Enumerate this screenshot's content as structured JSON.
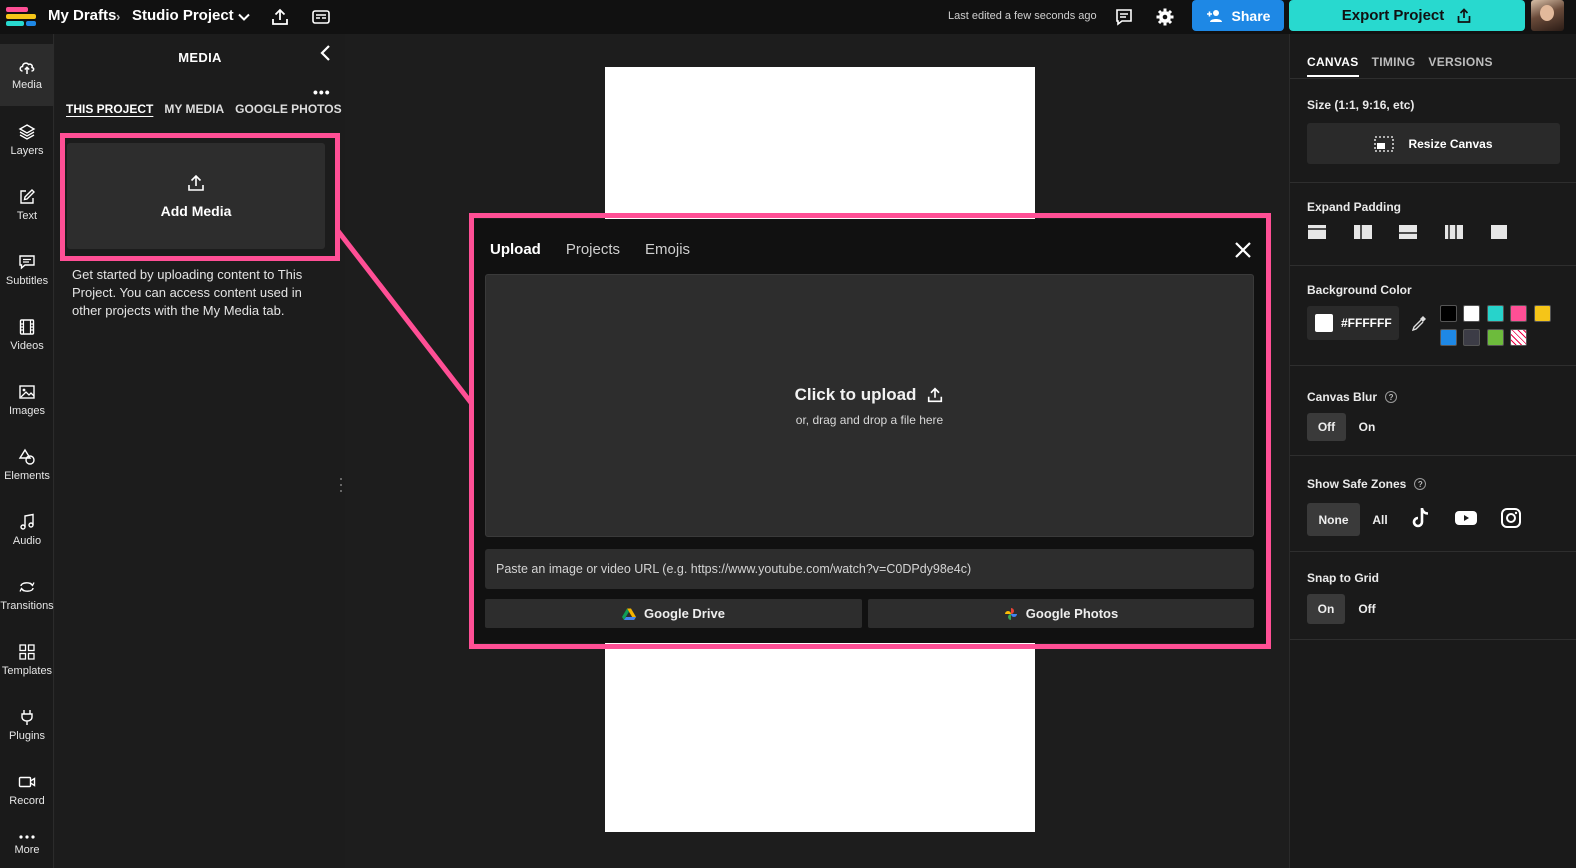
{
  "topbar": {
    "breadcrumb_root": "My Drafts",
    "breadcrumb_sep": "›",
    "project_name": "Studio Project",
    "last_edited": "Last edited a few seconds ago",
    "share_label": "Share",
    "export_label": "Export Project",
    "icons": [
      "upload-icon",
      "subtitles-icon",
      "comment-icon",
      "gear-icon",
      "add-person-icon",
      "export-icon"
    ]
  },
  "rail": {
    "items": [
      {
        "label": "Media",
        "icon": "cloud-upload-icon"
      },
      {
        "label": "Layers",
        "icon": "layers-icon"
      },
      {
        "label": "Text",
        "icon": "text-edit-icon"
      },
      {
        "label": "Subtitles",
        "icon": "subtitles-icon"
      },
      {
        "label": "Videos",
        "icon": "film-icon"
      },
      {
        "label": "Images",
        "icon": "image-icon"
      },
      {
        "label": "Elements",
        "icon": "shapes-icon"
      },
      {
        "label": "Audio",
        "icon": "music-note-icon"
      },
      {
        "label": "Transitions",
        "icon": "transition-icon"
      },
      {
        "label": "Templates",
        "icon": "grid-icon"
      },
      {
        "label": "Plugins",
        "icon": "plug-icon"
      },
      {
        "label": "Record",
        "icon": "camera-icon"
      },
      {
        "label": "More",
        "icon": "more-dots-icon"
      }
    ]
  },
  "media_panel": {
    "title": "MEDIA",
    "more": "•••",
    "tabs": [
      "THIS PROJECT",
      "MY MEDIA",
      "GOOGLE PHOTOS"
    ],
    "add_media_label": "Add Media",
    "help_text": "Get started by uploading content to This Project. You can access content used in other projects with the My Media tab."
  },
  "modal": {
    "tabs": [
      "Upload",
      "Projects",
      "Emojis"
    ],
    "drop_title": "Click to upload",
    "drop_subtitle": "or, drag and drop a file here",
    "url_placeholder": "Paste an image or video URL (e.g. https://www.youtube.com/watch?v=C0DPdy98e4c)",
    "google_drive_label": "Google Drive",
    "google_photos_label": "Google Photos"
  },
  "props": {
    "tabs": [
      "CANVAS",
      "TIMING",
      "VERSIONS"
    ],
    "size_label": "Size (1:1, 9:16, etc)",
    "resize_label": "Resize Canvas",
    "padding_label": "Expand Padding",
    "bg_label": "Background Color",
    "bg_value": "#FFFFFF",
    "swatches": [
      "#000000",
      "#ffffff",
      "#27d3cb",
      "#ff4f95",
      "#f5c518",
      "#1e88e5",
      "#3c3c46",
      "#6dbb3c",
      "transparent"
    ],
    "blur_label": "Canvas Blur",
    "blur_off": "Off",
    "blur_on": "On",
    "safe_label": "Show Safe Zones",
    "safe_none": "None",
    "safe_all": "All",
    "safe_icons": [
      "tiktok-icon",
      "youtube-icon",
      "instagram-icon"
    ],
    "grid_label": "Snap to Grid",
    "grid_on": "On",
    "grid_off": "Off"
  },
  "colors": {
    "highlight": "#ff4f95",
    "share": "#1e88e5",
    "export": "#28d9cf"
  }
}
